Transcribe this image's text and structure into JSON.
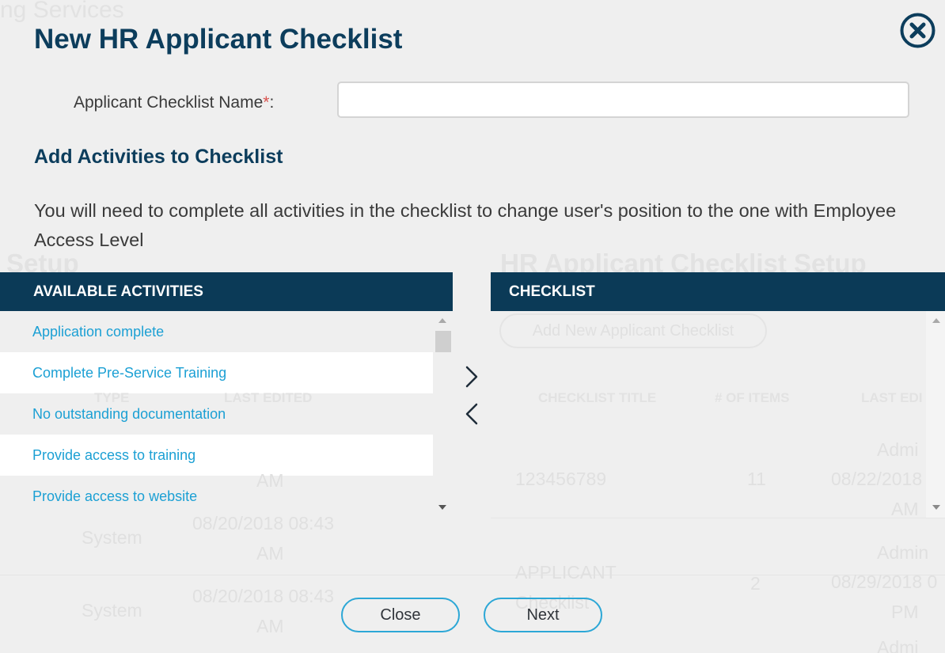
{
  "background": {
    "services_text": "ng Services",
    "left_heading": "Setup",
    "right_heading": "HR Applicant Checklist Setup",
    "add_button": "Add New Applicant Checklist",
    "left_table_headers": [
      "TYPE",
      "LAST EDITED"
    ],
    "right_table_headers": [
      "CHECKLIST TITLE",
      "# OF ITEMS",
      "LAST EDI"
    ],
    "left_rows": [
      {
        "type": "",
        "edited_line1": "",
        "edited_line2": "AM"
      },
      {
        "type": "System",
        "edited_line1": "08/20/2018 08:43",
        "edited_line2": "AM"
      },
      {
        "type": "System",
        "edited_line1": "08/20/2018 08:43",
        "edited_line2": "AM"
      }
    ],
    "right_rows": [
      {
        "title": "123456789",
        "items": "11",
        "edited_by": "Admi",
        "edited_date": "08/22/2018",
        "edited_time": "AM"
      },
      {
        "title": "APPLICANT Checklist",
        "items": "2",
        "edited_by": "Admin",
        "edited_date": "08/29/2018 0",
        "edited_time": "PM"
      },
      {
        "title": "",
        "items": "",
        "edited_by": "Admi",
        "edited_date": "",
        "edited_time": ""
      }
    ]
  },
  "modal": {
    "title": "New HR Applicant Checklist",
    "name_label": "Applicant Checklist Name",
    "required_mark": "*",
    "label_colon": ":",
    "name_value": "",
    "section_title": "Add Activities to Checklist",
    "description": "You will need to complete all activities in the checklist to change user's position to the one with Employee Access Level",
    "available_header": "AVAILABLE ACTIVITIES",
    "checklist_header": "CHECKLIST",
    "available_activities": [
      "Application complete",
      "Complete Pre-Service Training",
      "No outstanding documentation",
      "Provide access to training",
      "Provide access to website"
    ],
    "checklist_items": [],
    "buttons": {
      "close": "Close",
      "next": "Next"
    }
  },
  "icons": {
    "close": "close-circle-icon",
    "add": "chevron-right-icon",
    "remove": "chevron-left-icon"
  },
  "colors": {
    "header_bg": "#0b3a57",
    "title": "#0c3d5c",
    "link": "#1ca0d4",
    "button_border": "#2ca7d6",
    "required": "#d9534f"
  }
}
